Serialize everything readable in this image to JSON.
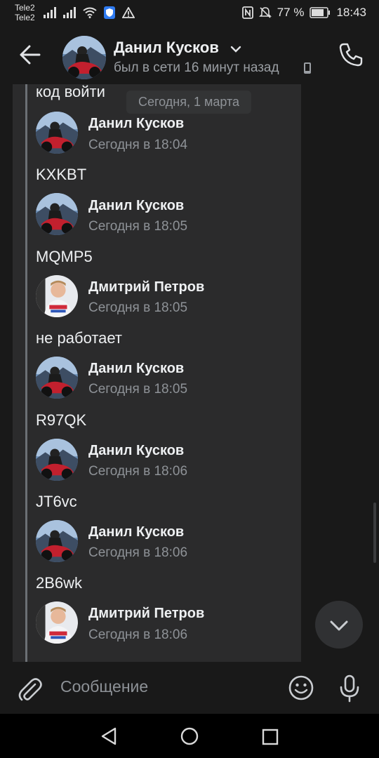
{
  "status_bar": {
    "carrier1": "Tele2",
    "carrier2": "Tele2",
    "battery": "77 %",
    "time": "18:43",
    "icons": [
      "signal-icon",
      "signal-icon",
      "wifi-icon",
      "shield-icon",
      "warning-icon",
      "nfc-icon",
      "mute-icon",
      "battery-icon"
    ]
  },
  "header": {
    "name": "Данил Кусков",
    "status": "был в сети 16 минут назад"
  },
  "date_pill": "Сегодня, 1 марта",
  "messages": [
    {
      "text": "код войти"
    },
    {
      "author": "Данил Кусков",
      "time": "Сегодня в 18:04",
      "text": "KXKBT",
      "avatar": "moto"
    },
    {
      "author": "Данил Кусков",
      "time": "Сегодня в 18:05",
      "text": "MQMP5",
      "avatar": "moto"
    },
    {
      "author": "Дмитрий Петров",
      "time": "Сегодня в 18:05",
      "text": "не работает",
      "avatar": "boy"
    },
    {
      "author": "Данил Кусков",
      "time": "Сегодня в 18:05",
      "text": "R97QK",
      "avatar": "moto"
    },
    {
      "author": "Данил Кусков",
      "time": "Сегодня в 18:06",
      "text": "JT6vc",
      "avatar": "moto"
    },
    {
      "author": "Данил Кусков",
      "time": "Сегодня в 18:06",
      "text": "2B6wk",
      "avatar": "moto"
    },
    {
      "author": "Дмитрий Петров",
      "time": "Сегодня в 18:06",
      "avatar": "boy"
    }
  ],
  "composer": {
    "placeholder": "Сообщение"
  },
  "colors": {
    "background": "#191919",
    "panel": "#2b2b2c",
    "text_primary": "#eef0f2",
    "text_secondary": "#8e9297"
  }
}
